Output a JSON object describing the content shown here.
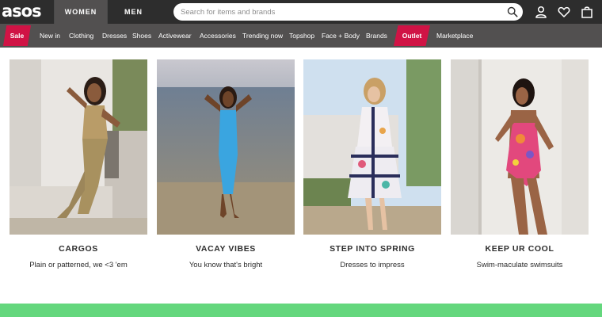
{
  "header": {
    "logo": "asos",
    "tabs": [
      {
        "label": "WOMEN",
        "active": true
      },
      {
        "label": "MEN",
        "active": false
      }
    ],
    "search": {
      "placeholder": "Search for items and brands",
      "value": ""
    },
    "icons": [
      "search-icon",
      "account-icon",
      "heart-icon",
      "bag-icon"
    ]
  },
  "nav": {
    "sale": "Sale",
    "items": [
      "New in",
      "Clothing",
      "Dresses",
      "Shoes",
      "Activewear",
      "Accessories",
      "Trending now",
      "Topshop",
      "Face + Body",
      "Brands"
    ],
    "outlet": "Outlet",
    "marketplace": "Marketplace"
  },
  "colors": {
    "topbar": "#2d2d2d",
    "navbar": "#525050",
    "accent_red": "#d01345",
    "green_band": "#64d77d"
  },
  "cards": [
    {
      "title": "CARGOS",
      "subtitle": "Plain or patterned, we <3 'em"
    },
    {
      "title": "VACAY VIBES",
      "subtitle": "You know that's bright"
    },
    {
      "title": "STEP INTO SPRING",
      "subtitle": "Dresses to impress"
    },
    {
      "title": "KEEP UR COOL",
      "subtitle": "Swim-maculate swimsuits"
    }
  ]
}
